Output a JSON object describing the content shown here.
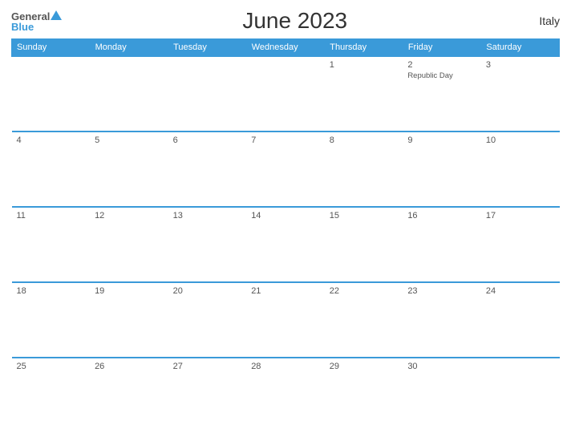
{
  "logo": {
    "general": "General",
    "blue": "Blue",
    "triangle": "▲"
  },
  "title": "June 2023",
  "country": "Italy",
  "headers": [
    "Sunday",
    "Monday",
    "Tuesday",
    "Wednesday",
    "Thursday",
    "Friday",
    "Saturday"
  ],
  "weeks": [
    [
      {
        "day": "",
        "holiday": ""
      },
      {
        "day": "",
        "holiday": ""
      },
      {
        "day": "",
        "holiday": ""
      },
      {
        "day": "",
        "holiday": ""
      },
      {
        "day": "1",
        "holiday": ""
      },
      {
        "day": "2",
        "holiday": "Republic Day"
      },
      {
        "day": "3",
        "holiday": ""
      }
    ],
    [
      {
        "day": "4",
        "holiday": ""
      },
      {
        "day": "5",
        "holiday": ""
      },
      {
        "day": "6",
        "holiday": ""
      },
      {
        "day": "7",
        "holiday": ""
      },
      {
        "day": "8",
        "holiday": ""
      },
      {
        "day": "9",
        "holiday": ""
      },
      {
        "day": "10",
        "holiday": ""
      }
    ],
    [
      {
        "day": "11",
        "holiday": ""
      },
      {
        "day": "12",
        "holiday": ""
      },
      {
        "day": "13",
        "holiday": ""
      },
      {
        "day": "14",
        "holiday": ""
      },
      {
        "day": "15",
        "holiday": ""
      },
      {
        "day": "16",
        "holiday": ""
      },
      {
        "day": "17",
        "holiday": ""
      }
    ],
    [
      {
        "day": "18",
        "holiday": ""
      },
      {
        "day": "19",
        "holiday": ""
      },
      {
        "day": "20",
        "holiday": ""
      },
      {
        "day": "21",
        "holiday": ""
      },
      {
        "day": "22",
        "holiday": ""
      },
      {
        "day": "23",
        "holiday": ""
      },
      {
        "day": "24",
        "holiday": ""
      }
    ],
    [
      {
        "day": "25",
        "holiday": ""
      },
      {
        "day": "26",
        "holiday": ""
      },
      {
        "day": "27",
        "holiday": ""
      },
      {
        "day": "28",
        "holiday": ""
      },
      {
        "day": "29",
        "holiday": ""
      },
      {
        "day": "30",
        "holiday": ""
      },
      {
        "day": "",
        "holiday": ""
      }
    ]
  ]
}
